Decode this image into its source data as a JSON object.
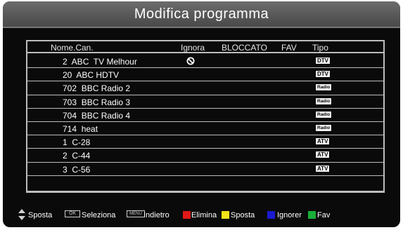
{
  "title": "Modifica programma",
  "header": {
    "name": "Nome.Can.",
    "ignore": "Ignora",
    "locked": "BLOCCATO",
    "fav": "FAV",
    "type": "Tipo"
  },
  "channels": [
    {
      "name": "2  ABC  TV Melhour",
      "ignored": true,
      "type": "DTV"
    },
    {
      "name": "20  ABC HDTV",
      "ignored": false,
      "type": "DTV"
    },
    {
      "name": "702  BBC Radio 2",
      "ignored": false,
      "type": "Radio"
    },
    {
      "name": "703  BBC Radio 3",
      "ignored": false,
      "type": "Radio"
    },
    {
      "name": "704  BBC Radio 4",
      "ignored": false,
      "type": "Radio"
    },
    {
      "name": "714  heat",
      "ignored": false,
      "type": "Radio"
    },
    {
      "name": "1  C-28",
      "ignored": false,
      "type": "ATV"
    },
    {
      "name": "2  C-44",
      "ignored": false,
      "type": "ATV"
    },
    {
      "name": "3  C-56",
      "ignored": false,
      "type": "ATV"
    }
  ],
  "footer": {
    "move": "Sposta",
    "ok_key": "OK",
    "select": "Seleziona",
    "menu_key": "MENU",
    "back": "Indietro",
    "delete": "Elimina",
    "move2": "Sposta",
    "ignore": "Ignorer",
    "fav": "Fav"
  },
  "colors": {
    "red": "#e01818",
    "yellow": "#f2e21a",
    "blue": "#1a1ad0",
    "green": "#18b038"
  }
}
